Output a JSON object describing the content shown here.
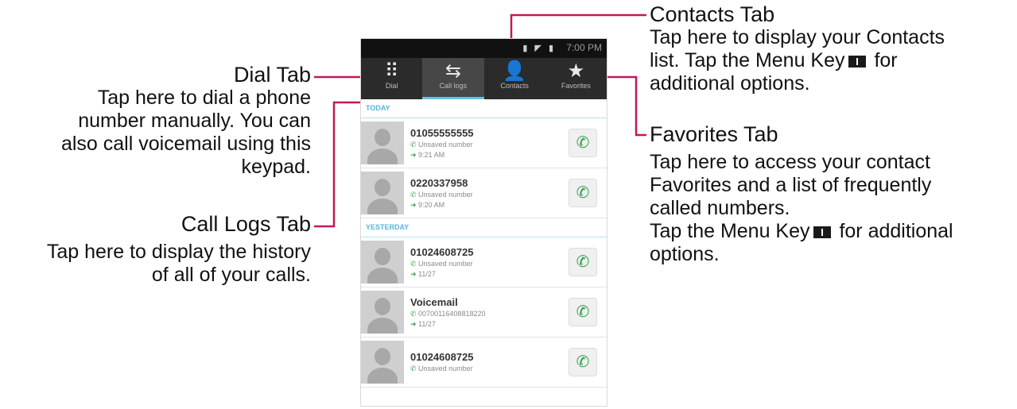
{
  "phone": {
    "status_time": "7:00 PM",
    "tabs": [
      {
        "label": "Dial",
        "icon": "dialpad-icon"
      },
      {
        "label": "Call logs",
        "icon": "call-logs-icon"
      },
      {
        "label": "Contacts",
        "icon": "contact-icon"
      },
      {
        "label": "Favorites",
        "icon": "star-icon"
      }
    ],
    "sections": {
      "today": "TODAY",
      "yesterday": "YESTERDAY"
    },
    "entries": [
      {
        "name": "01055555555",
        "type": "Unsaved number",
        "time": "9:21 AM"
      },
      {
        "name": "0220337958",
        "type": "Unsaved number",
        "time": "9:20 AM"
      },
      {
        "name": "01024608725",
        "type": "Unsaved number",
        "time": "11/27"
      },
      {
        "name": "Voicemail",
        "type": "00700116408818220",
        "time": "11/27"
      },
      {
        "name": "01024608725",
        "type": "Unsaved number",
        "time": ""
      }
    ]
  },
  "callouts": {
    "dial": {
      "title": "Dial Tab",
      "body": [
        "Tap here to dial a phone",
        "number manually. You can",
        "also call voicemail using this",
        "keypad."
      ]
    },
    "call_logs": {
      "title": "Call Logs Tab",
      "body": [
        "Tap here to display the history",
        "of all of your calls."
      ]
    },
    "contacts": {
      "title": "Contacts Tab",
      "line1": "Tap here to display your Contacts",
      "line2_pre": "list. Tap the ",
      "menu_key": "Menu Key",
      "line2_post": " for",
      "line3": "additional options."
    },
    "favorites": {
      "title": "Favorites Tab",
      "body": [
        "Tap here to access your contact",
        "Favorites and a list of frequently",
        "called numbers."
      ],
      "line4_pre": "Tap the ",
      "menu_key": "Menu Key",
      "line4_post": " for additional",
      "line5": "options."
    }
  },
  "colors": {
    "leader": "#c2185b",
    "tab_indicator": "#5ec3e6",
    "call_green": "#2f9e4a"
  }
}
